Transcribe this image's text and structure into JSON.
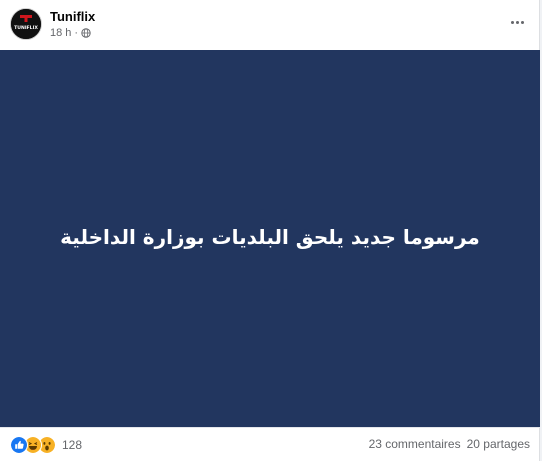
{
  "header": {
    "page_name": "Tuniflix",
    "time": "18 h",
    "separator": "·",
    "avatar_logo_text": "TUNIFLIX",
    "privacy_icon": "globe-icon",
    "more_icon": "more-options-icon"
  },
  "post": {
    "headline": "مرسوما جديد يلحق البلديات بوزارة الداخلية",
    "image_background": "#22365f"
  },
  "footer": {
    "reaction_icons": [
      "like-icon",
      "haha-icon",
      "wow-icon"
    ],
    "reaction_count": "128",
    "comments": "23 commentaires",
    "shares": "20 partages"
  },
  "colors": {
    "like": "#1877f2",
    "emoji": "#f7b125",
    "brand": "#d0161d"
  }
}
